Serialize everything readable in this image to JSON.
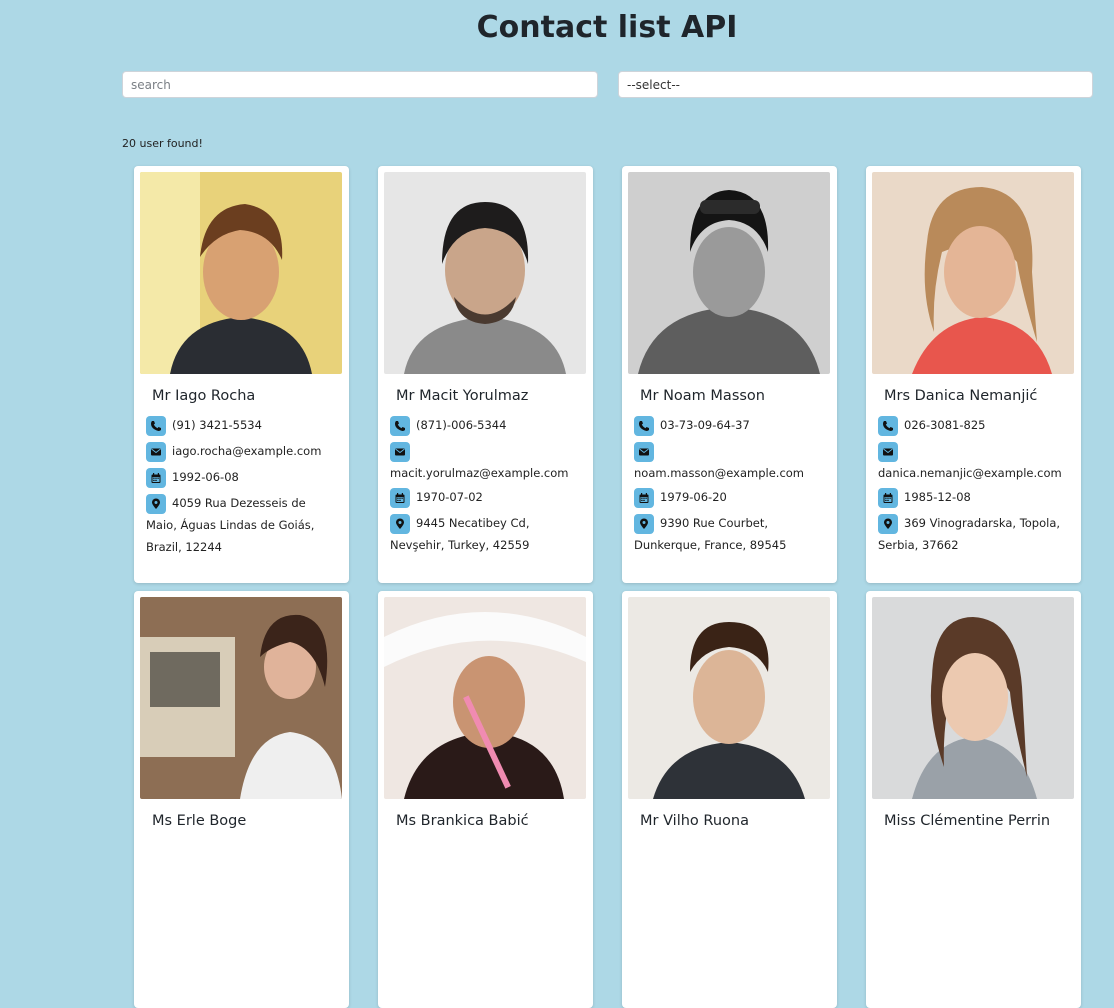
{
  "header": {
    "title": "Contact list API"
  },
  "filters": {
    "search_placeholder": "search",
    "select_value": "--select--"
  },
  "results": {
    "count_text": "20 user found!"
  },
  "colors": {
    "background": "#add8e6",
    "icon_bg": "#62b6e0",
    "card_bg": "#ffffff"
  },
  "icons": {
    "phone": "phone-icon",
    "email": "envelope-icon",
    "dob": "calendar-icon",
    "location": "map-marker-icon"
  },
  "contacts": [
    {
      "name": "Mr Iago Rocha",
      "phone": "(91) 3421-5534",
      "email": "iago.rocha@example.com",
      "dob": "1992-06-08",
      "address": "4059 Rua Dezesseis de Maio, Águas Lindas de Goiás, Brazil, 12244"
    },
    {
      "name": "Mr Macit Yorulmaz",
      "phone": "(871)-006-5344",
      "email": "macit.yorulmaz@example.com",
      "dob": "1970-07-02",
      "address": "9445 Necatibey Cd, Nevşehir, Turkey, 42559"
    },
    {
      "name": "Mr Noam Masson",
      "phone": "03-73-09-64-37",
      "email": "noam.masson@example.com",
      "dob": "1979-06-20",
      "address": "9390 Rue Courbet, Dunkerque, France, 89545"
    },
    {
      "name": "Mrs Danica Nemanjić",
      "phone": "026-3081-825",
      "email": "danica.nemanjic@example.com",
      "dob": "1985-12-08",
      "address": "369 Vinogradarska, Topola, Serbia, 37662"
    },
    {
      "name": "Ms Erle Boge"
    },
    {
      "name": "Ms Brankica Babić"
    },
    {
      "name": "Mr Vilho Ruona"
    },
    {
      "name": "Miss Clémentine Perrin"
    }
  ]
}
